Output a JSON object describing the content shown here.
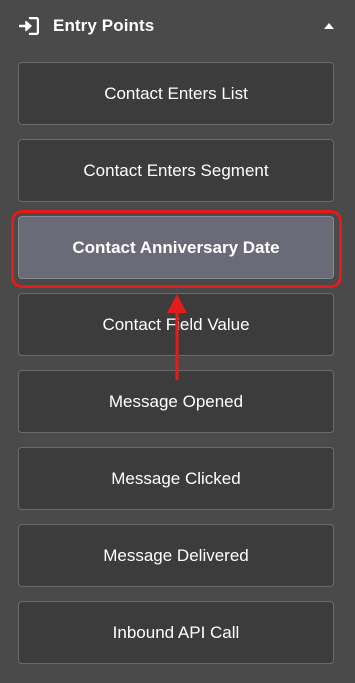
{
  "header": {
    "title": "Entry Points",
    "entry_icon": "sign-in-icon",
    "collapse_icon": "caret-up-icon"
  },
  "entry_points": [
    {
      "label": "Contact Enters List",
      "selected": false
    },
    {
      "label": "Contact Enters Segment",
      "selected": false
    },
    {
      "label": "Contact Anniversary Date",
      "selected": true
    },
    {
      "label": "Contact Field Value",
      "selected": false
    },
    {
      "label": "Message Opened",
      "selected": false
    },
    {
      "label": "Message Clicked",
      "selected": false
    },
    {
      "label": "Message Delivered",
      "selected": false
    },
    {
      "label": "Inbound API Call",
      "selected": false
    }
  ],
  "annotation": {
    "color": "#e31b1b",
    "highlighted_item": "Contact Anniversary Date"
  },
  "colors": {
    "panel_bg": "#4a4a4a",
    "button_bg": "#3c3c3c",
    "button_border": "#6a6a6a",
    "selected_bg": "#6b6b78"
  }
}
